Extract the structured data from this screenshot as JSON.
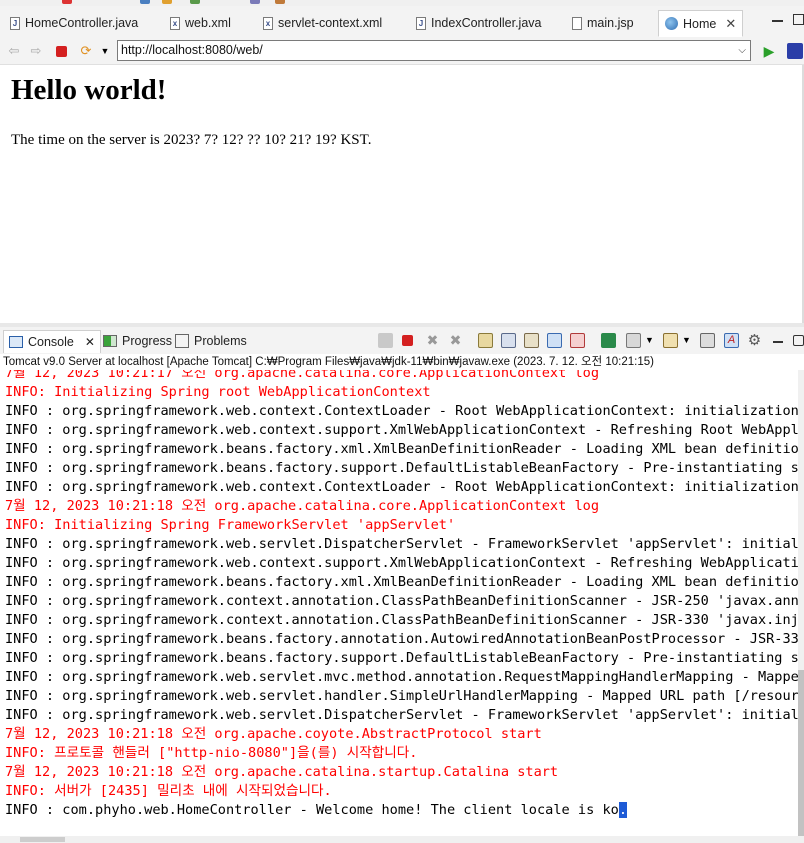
{
  "editor_tabs": [
    {
      "label": "HomeController.java",
      "icon": "java-file-icon"
    },
    {
      "label": "web.xml",
      "icon": "xml-file-icon"
    },
    {
      "label": "servlet-context.xml",
      "icon": "xml-file-icon"
    },
    {
      "label": "IndexController.java",
      "icon": "java-file-icon"
    },
    {
      "label": "main.jsp",
      "icon": "jsp-file-icon"
    },
    {
      "label": "Home",
      "icon": "globe-icon",
      "active": true
    }
  ],
  "browser": {
    "url": "http://localhost:8080/web/",
    "heading": "Hello world!",
    "server_time": "The time on the server is 2023? 7? 12? ?? 10? 21? 19? KST."
  },
  "console_view": {
    "tabs": [
      {
        "label": "Console",
        "active": true
      },
      {
        "label": "Progress"
      },
      {
        "label": "Problems"
      }
    ],
    "process_info": "Tomcat v9.0 Server at localhost [Apache Tomcat] C:₩Program Files₩java₩jdk-11₩bin₩javaw.exe  (2023. 7. 12. 오전 10:21:15)",
    "lines": [
      {
        "t": "7월 12, 2023 10:21:17 오전 org.apache.catalina.core.ApplicationContext log",
        "k": "err"
      },
      {
        "t": "INFO: Initializing Spring root WebApplicationContext",
        "k": "err"
      },
      {
        "t": "INFO : org.springframework.web.context.ContextLoader - Root WebApplicationContext: initialization s",
        "k": "info"
      },
      {
        "t": "INFO : org.springframework.web.context.support.XmlWebApplicationContext - Refreshing Root WebApplic",
        "k": "info"
      },
      {
        "t": "INFO : org.springframework.beans.factory.xml.XmlBeanDefinitionReader - Loading XML bean definitions",
        "k": "info"
      },
      {
        "t": "INFO : org.springframework.beans.factory.support.DefaultListableBeanFactory - Pre-instantiating sin",
        "k": "info"
      },
      {
        "t": "INFO : org.springframework.web.context.ContextLoader - Root WebApplicationContext: initialization c",
        "k": "info"
      },
      {
        "t": "7월 12, 2023 10:21:18 오전 org.apache.catalina.core.ApplicationContext log",
        "k": "err"
      },
      {
        "t": "INFO: Initializing Spring FrameworkServlet 'appServlet'",
        "k": "err"
      },
      {
        "t": "INFO : org.springframework.web.servlet.DispatcherServlet - FrameworkServlet 'appServlet': initializ",
        "k": "info"
      },
      {
        "t": "INFO : org.springframework.web.context.support.XmlWebApplicationContext - Refreshing WebApplication",
        "k": "info"
      },
      {
        "t": "INFO : org.springframework.beans.factory.xml.XmlBeanDefinitionReader - Loading XML bean definitions",
        "k": "info"
      },
      {
        "t": "INFO : org.springframework.context.annotation.ClassPathBeanDefinitionScanner - JSR-250 'javax.annot",
        "k": "info"
      },
      {
        "t": "INFO : org.springframework.context.annotation.ClassPathBeanDefinitionScanner - JSR-330 'javax.injec",
        "k": "info"
      },
      {
        "t": "INFO : org.springframework.beans.factory.annotation.AutowiredAnnotationBeanPostProcessor - JSR-330",
        "k": "info"
      },
      {
        "t": "INFO : org.springframework.beans.factory.support.DefaultListableBeanFactory - Pre-instantiating sin",
        "k": "info"
      },
      {
        "t": "INFO : org.springframework.web.servlet.mvc.method.annotation.RequestMappingHandlerMapping - Mapped",
        "k": "info"
      },
      {
        "t": "INFO : org.springframework.web.servlet.handler.SimpleUrlHandlerMapping - Mapped URL path [/resource",
        "k": "info"
      },
      {
        "t": "INFO : org.springframework.web.servlet.DispatcherServlet - FrameworkServlet 'appServlet': initializ",
        "k": "info"
      },
      {
        "t": "7월 12, 2023 10:21:18 오전 org.apache.coyote.AbstractProtocol start",
        "k": "err"
      },
      {
        "t": "INFO: 프로토콜 핸들러 [\"http-nio-8080\"]을(를) 시작합니다.",
        "k": "err"
      },
      {
        "t": "7월 12, 2023 10:21:18 오전 org.apache.catalina.startup.Catalina start",
        "k": "err"
      },
      {
        "t": "INFO: 서버가 [2435] 밀리초 내에 시작되었습니다.",
        "k": "err"
      },
      {
        "t": "INFO : com.phyho.web.HomeController - Welcome home! The client locale is ko",
        "k": "info",
        "cursor": "."
      }
    ]
  },
  "colors": {
    "stderr": "#ff0000",
    "stdout": "#000000",
    "cursor": "#1e5bd6"
  }
}
